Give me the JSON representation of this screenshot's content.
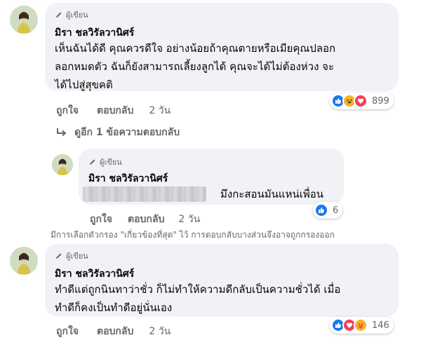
{
  "comments": [
    {
      "author_badge": "ผู้เขียน",
      "author": "มิรา ชลวิรัลวานิศร์",
      "text_lines": [
        "เห็นฉันได้ดี คุณควรดีใจ อย่างน้อยถ้าคุณตายหรือเมียคุณปลอก",
        "ลอกหมดตัว ฉันก็ยังสามารถเลี้ยงลูกได้ คุณจะได้ไม่ต้องห่วง จะ",
        "ได้ไปสู่สุขคติ"
      ],
      "like_label": "ถูกใจ",
      "reply_label": "ตอบกลับ",
      "timestamp": "2 วัน",
      "reactions": {
        "icons": [
          "like-icon",
          "haha-icon",
          "love-icon"
        ],
        "count": "899"
      }
    },
    {
      "author_badge": "ผู้เขียน",
      "author": "มิรา ชลวิรัลวานิศร์",
      "text_lines": [
        "มึงกะสอนมันแหน่เพื่อน"
      ],
      "like_label": "ถูกใจ",
      "reply_label": "ตอบกลับ",
      "timestamp": "2 วัน",
      "reactions": {
        "icons": [
          "like-icon"
        ],
        "count": "6"
      }
    },
    {
      "author_badge": "ผู้เขียน",
      "author": "มิรา ชลวิรัลวานิศร์",
      "text_lines": [
        "ทำดีแต่ถูกนินทาว่าชั่ว ก็ไม่ทำให้ความดีกลับเป็นความชั่วได้ เมื่อ",
        "ทำดีก็คงเป็นทำดีอยู่นั่นเอง"
      ],
      "like_label": "ถูกใจ",
      "reply_label": "ตอบกลับ",
      "timestamp": "2 วัน",
      "reactions": {
        "icons": [
          "like-icon",
          "love-icon",
          "care-icon"
        ],
        "count": "146"
      }
    }
  ],
  "view_more_replies": "ดูอีก 1 ข้อความตอบกลับ",
  "filter_note": "มีการเลือกตัวกรอง \"เกี่ยวข้องที่สุด\" ไว้ การตอบกลับบางส่วนจึงอาจถูกกรองออก",
  "colors": {
    "like": "#1877f2",
    "love": "#f33e58",
    "haha": "#f7b125",
    "bubble": "#f0f2f5",
    "meta": "#65676b"
  }
}
